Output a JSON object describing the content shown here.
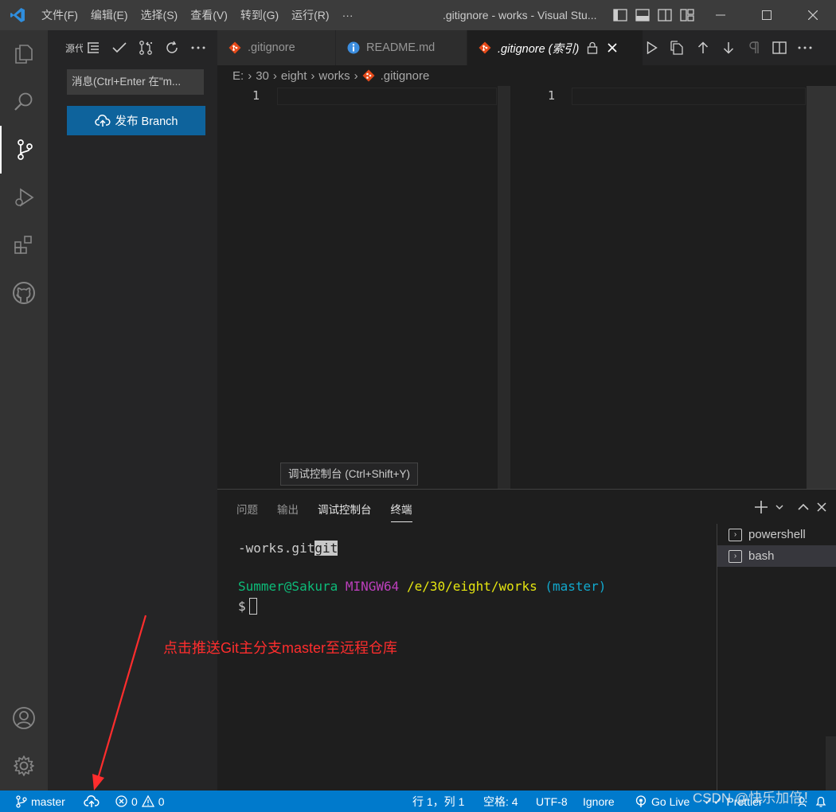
{
  "titlebar": {
    "menu": [
      "文件(F)",
      "编辑(E)",
      "选择(S)",
      "查看(V)",
      "转到(G)",
      "运行(R)",
      "···"
    ],
    "window_title": ".gitignore - works - Visual Stu..."
  },
  "sidebar": {
    "title": "源代码管理",
    "commit_placeholder": "消息(Ctrl+Enter 在\"m...",
    "publish_label": "发布 Branch"
  },
  "tabs": [
    {
      "label": ".gitignore",
      "icon": "git-diamond-icon"
    },
    {
      "label": "README.md",
      "icon": "info-icon"
    },
    {
      "label": ".gitignore (索引)",
      "icon": "git-diamond-icon",
      "active": true
    }
  ],
  "breadcrumb": [
    "E:",
    "30",
    "eight",
    "works",
    ".gitignore"
  ],
  "editor": {
    "left_line": "1",
    "right_line": "1"
  },
  "tooltip": "调试控制台 (Ctrl+Shift+Y)",
  "panel": {
    "tabs": [
      "问题",
      "输出",
      "调试控制台",
      "终端"
    ],
    "active_tab": "终端",
    "terminal": {
      "line1_prefix": "-works.git",
      "line1_highlight": "git",
      "prompt_user": "Summer@Sakura",
      "prompt_env": "MINGW64",
      "prompt_path": "/e/30/eight/works",
      "prompt_branch": "(master)",
      "prompt_symbol": "$"
    },
    "terminal_list": [
      "powershell",
      "bash"
    ],
    "selected_terminal": "bash"
  },
  "annotation": "点击推送Git主分支master至远程仓库",
  "statusbar": {
    "branch": "master",
    "errors": "0",
    "warnings": "0",
    "position": "行 1，列 1",
    "spaces": "空格: 4",
    "encoding": "UTF-8",
    "language": "Ignore",
    "golive": "Go Live",
    "prettier": "Prettier"
  },
  "watermark": "CSDN @快乐加倍！",
  "colors": {
    "accent": "#007acc",
    "button": "#0e639c",
    "annotation": "#ff2d2d"
  }
}
